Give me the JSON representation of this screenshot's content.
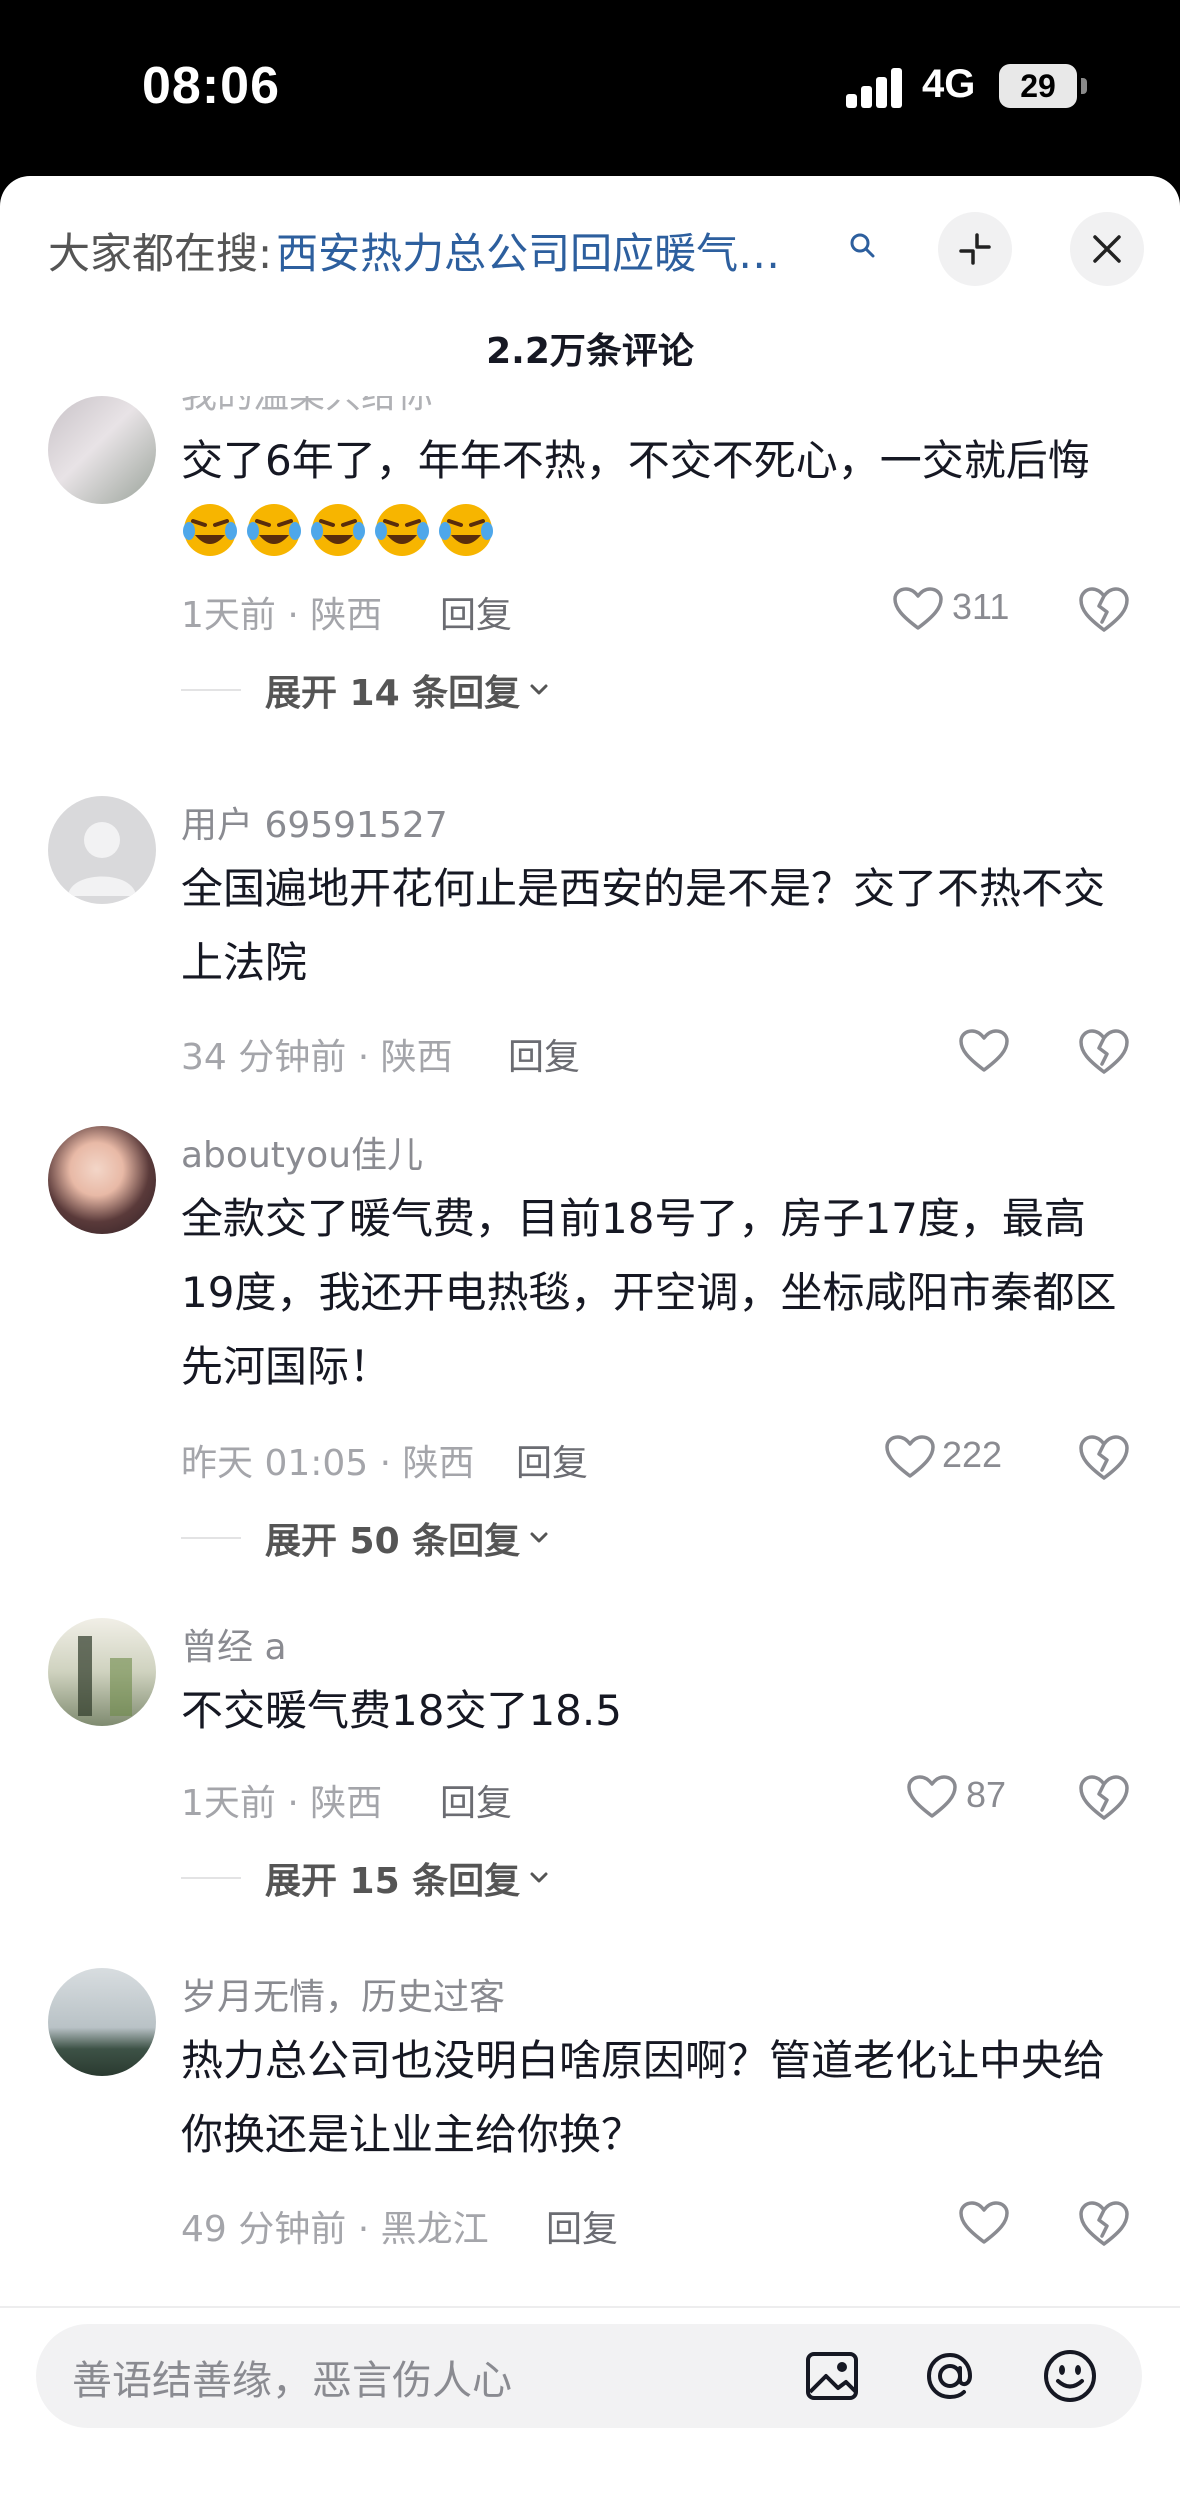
{
  "status_bar": {
    "time": "08:06",
    "network": "4G",
    "battery": "29"
  },
  "header": {
    "search_prefix": "大家都在搜:",
    "search_term": "西安热力总公司回应暖气…",
    "comment_count": "2.2万条评论"
  },
  "comments": [
    {
      "username": "我的温柔只给你",
      "text": "交了6年了，年年不热，不交不死心，一交就后悔",
      "emoji_count": 5,
      "emoji_name": "crying-laughing-emoji",
      "meta": "1天前 · 陕西",
      "reply": "回复",
      "likes": "311",
      "expand": "展开 14 条回复"
    },
    {
      "username": "用户 69591527",
      "text": "全国遍地开花何止是西安的是不是？交了不热不交上法院",
      "meta": "34 分钟前 · 陕西",
      "reply": "回复",
      "likes": ""
    },
    {
      "username": "aboutyou佳儿",
      "text": "全款交了暖气费，目前18号了，房子17度，最高19度，我还开电热毯，开空调，坐标咸阳市秦都区先河国际！",
      "meta": "昨天 01:05 · 陕西",
      "reply": "回复",
      "likes": "222",
      "expand": "展开 50 条回复"
    },
    {
      "username": "曾经 a",
      "text": "不交暖气费18交了18.5",
      "meta": "1天前 · 陕西",
      "reply": "回复",
      "likes": "87",
      "expand": "展开 15 条回复"
    },
    {
      "username": "岁月无情，历史过客",
      "text": "热力总公司也没明白啥原因啊？管道老化让中央给你换还是让业主给你换？",
      "meta": "49 分钟前 · 黑龙江",
      "reply": "回复",
      "likes": ""
    }
  ],
  "input": {
    "placeholder": "善语结善缘，恶言伤人心"
  },
  "colors": {
    "link_blue": "#2d5f9e",
    "text_primary": "#161823",
    "text_secondary": "#8a8b91",
    "emoji_yellow": "#f7b500"
  },
  "icons": [
    "search-icon",
    "minimize-icon",
    "close-icon",
    "heart-icon",
    "broken-heart-icon",
    "chevron-down-icon",
    "image-icon",
    "at-icon",
    "smile-icon"
  ]
}
